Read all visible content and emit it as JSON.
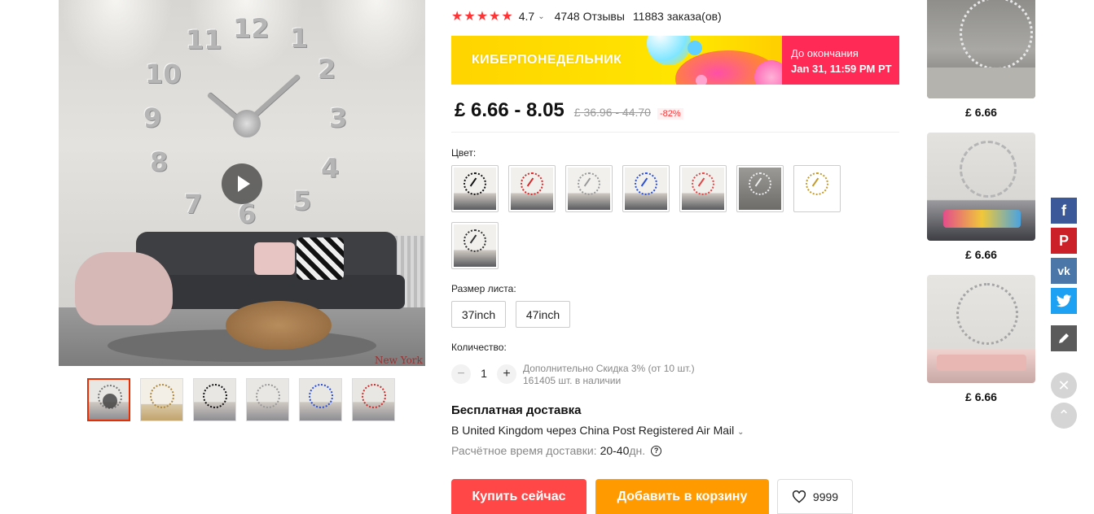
{
  "rating": {
    "stars": "★★★★★",
    "value": "4.7",
    "caret": "⌄",
    "reviews": "4748 Отзывы",
    "orders": "11883 заказа(ов)"
  },
  "promo": {
    "title": "КИБЕРПОНЕДЕЛЬНИК",
    "countdown_label": "До окончания",
    "countdown_date": "Jan 31, 11:59 PM PT"
  },
  "price": {
    "current": "£ 6.66 - 8.05",
    "original": "£ 36.96 - 44.70",
    "discount": "-82%"
  },
  "color": {
    "label": "Цвет:"
  },
  "size": {
    "label": "Размер листа:",
    "options": [
      "37inch",
      "47inch"
    ]
  },
  "quantity": {
    "label": "Количество:",
    "value": "1",
    "minus": "−",
    "plus": "+",
    "note_discount": "Дополнительно Скидка 3% (от 10 шт.)",
    "note_stock": "161405 шт. в наличии"
  },
  "shipping": {
    "title": "Бесплатная доставка",
    "line": "В United Kingdom через China Post Registered Air Mail",
    "caret": "⌄",
    "time_label": "Расчётное время доставки:",
    "time_value": "20-40",
    "time_unit": "дн.",
    "help": "?"
  },
  "actions": {
    "buy": "Купить сейчас",
    "cart": "Добавить в корзину",
    "wish_count": "9999"
  },
  "main_image": {
    "clock_numbers": [
      "12",
      "1",
      "2",
      "3",
      "4",
      "5",
      "6",
      "7",
      "8",
      "9",
      "10",
      "11"
    ],
    "caption": "New York"
  },
  "recommendations": [
    {
      "price": "£ 6.66"
    },
    {
      "price": "£ 6.66"
    },
    {
      "price": "£ 6.66"
    }
  ],
  "social": {
    "facebook": "f",
    "pinterest": "P",
    "vk": "vk",
    "close": "✕",
    "up": "⌃"
  }
}
